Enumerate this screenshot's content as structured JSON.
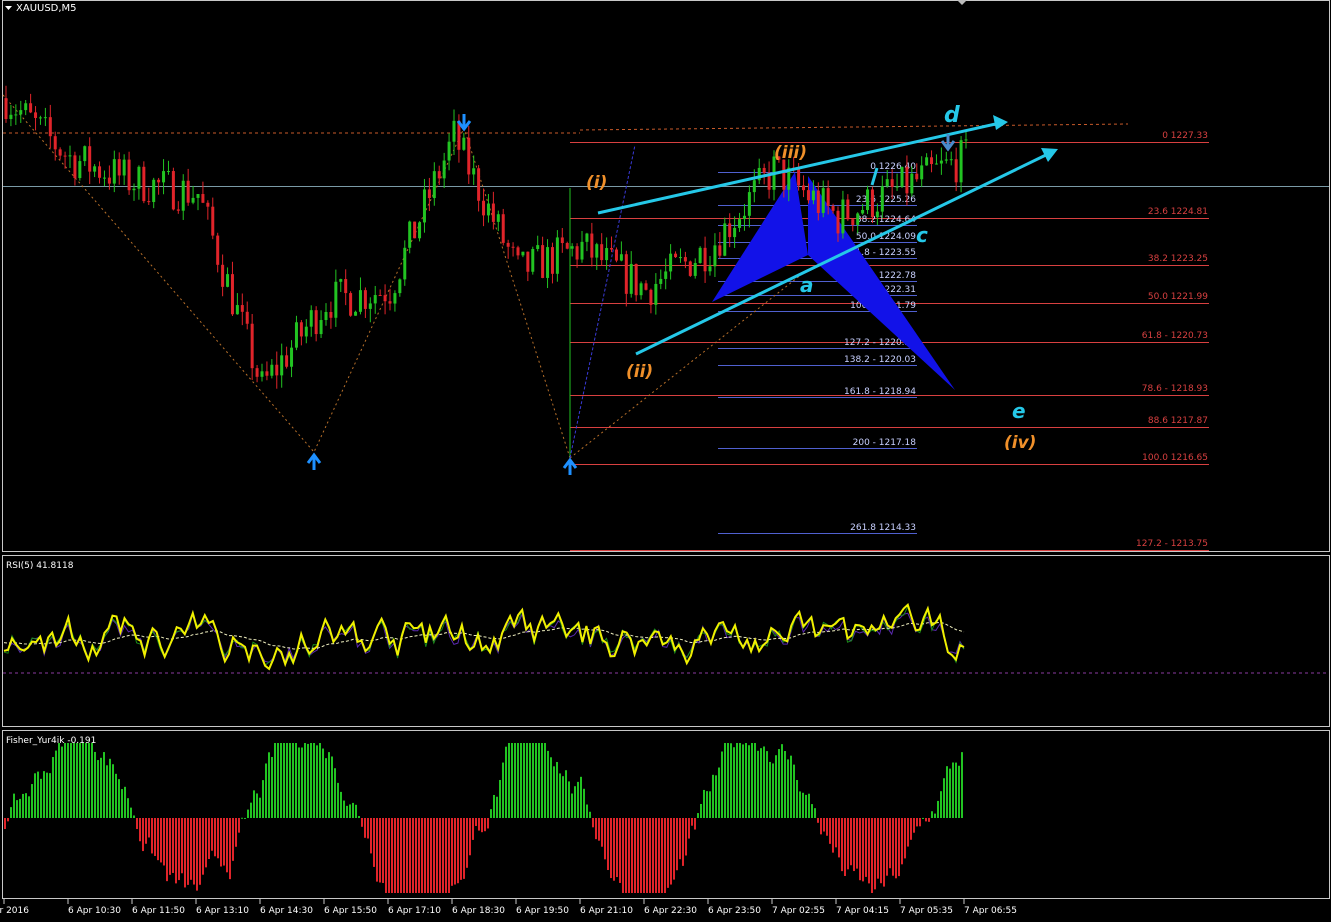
{
  "window": {
    "title": "XAUUSD,M5",
    "rsi_label": "RSI(5) 41.8118",
    "fisher_label": "Fisher_Yur4ik -0.191"
  },
  "colors": {
    "background": "#000000",
    "bull": "#22c322",
    "bear": "#e0242a",
    "wave_orange": "#f0902a",
    "wave_cyan": "#25c8e8",
    "fib_red": "#d84040",
    "fib_blue": "#5060d0",
    "pattern_blue": "#1010e0",
    "rsi": "#f0f000",
    "pane_border": "#c8c8c8"
  },
  "time_axis": [
    "6 Apr 2016",
    "6 Apr 10:30",
    "6 Apr 11:50",
    "6 Apr 13:10",
    "6 Apr 14:30",
    "6 Apr 15:50",
    "6 Apr 17:10",
    "6 Apr 18:30",
    "6 Apr 19:50",
    "6 Apr 21:10",
    "6 Apr 22:30",
    "6 Apr 23:50",
    "7 Apr 02:55",
    "7 Apr 04:15",
    "7 Apr 05:35",
    "7 Apr 06:55"
  ],
  "fib_red_levels": [
    "0 1227.33",
    "23.6 1224.81",
    "38.2 1223.25",
    "50.0 1221.99",
    "61.8 - 1220.73",
    "78.6 - 1218.93",
    "88.6 1217.87",
    "100.0 1216.65",
    "127.2 - 1213.75"
  ],
  "fib_blue_levels": [
    "0 1226.40",
    "23.6 1225.26",
    "38.2 1224.64",
    "50.0 1224.09",
    "61.8 - 1223.55",
    "78.6 - 1222.78",
    "88.6 1222.31",
    "100.0 1221.79",
    "127.2 - 1220.54",
    "138.2 - 1220.03",
    "161.8 - 1218.94",
    "200 - 1217.18",
    "261.8 1214.33"
  ],
  "wave_labels": {
    "w1": "(i)",
    "w2": "(ii)",
    "w3": "(iii)",
    "w4": "(iv)",
    "a": "a",
    "c": "c",
    "d": "d",
    "e": "e"
  },
  "chart_data": [
    {
      "type": "candlestick",
      "symbol": "XAUUSD",
      "timeframe": "M5",
      "x": [
        "6 Apr 2016",
        "6 Apr 10:30",
        "6 Apr 11:50",
        "6 Apr 13:10",
        "6 Apr 14:30",
        "6 Apr 15:50",
        "6 Apr 17:10",
        "6 Apr 18:30",
        "6 Apr 19:50",
        "6 Apr 21:10",
        "6 Apr 22:30",
        "6 Apr 23:50",
        "7 Apr 02:55",
        "7 Apr 04:15",
        "7 Apr 05:35",
        "7 Apr 06:55"
      ],
      "close_path": [
        1228.6,
        1226.6,
        1225.8,
        1225.4,
        1218.9,
        1221.8,
        1222.2,
        1227.3,
        1222.8,
        1223.6,
        1222.2,
        1223.6,
        1226.2,
        1224.6,
        1225.6,
        1226.6
      ],
      "swing_points": [
        {
          "time": "6 Apr 14:30",
          "price": 1217.1
        },
        {
          "time": "6 Apr 18:30",
          "price": 1227.33
        },
        {
          "time": "6 Apr 21:10",
          "price": 1216.65
        },
        {
          "time": "7 Apr 02:55",
          "price": 1225.9
        },
        {
          "time": "7 Apr 06:55",
          "price": 1227.0
        }
      ],
      "ylim": [
        1213.2,
        1229.5
      ]
    },
    {
      "type": "line",
      "name": "RSI(5)",
      "current_value": 41.8118,
      "ylim": [
        0,
        100
      ]
    },
    {
      "type": "bar",
      "name": "Fisher_Yur4ik",
      "current_value": -0.191
    }
  ]
}
